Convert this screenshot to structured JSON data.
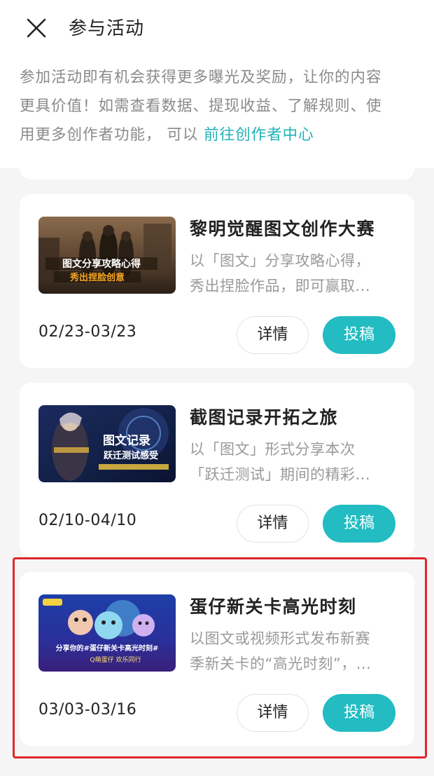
{
  "header": {
    "title": "参与活动",
    "close_icon": "close-icon"
  },
  "intro": {
    "line1": "参加活动即有机会获得更多曝光及奖励，让你的内容",
    "line2": "更具价值！如需查看数据、提现收益、了解规则、使",
    "line3_prefix": "用更多创作者功能， 可以 ",
    "link": "前往创作者中心"
  },
  "activities": [
    {
      "title": "黎明觉醒图文创作大赛",
      "desc_line1": "以「图文」分享攻略心得，",
      "desc_line2": "秀出捏脸作品，即可赢取...",
      "date": "02/23-03/23",
      "detail_label": "详情",
      "submit_label": "投稿",
      "banner_text1": "图文分享攻略心得",
      "banner_text2": "秀出捏脸创意"
    },
    {
      "title": "截图记录开拓之旅",
      "desc_line1": "以「图文」形式分享本次",
      "desc_line2": "「跃迁测试」期间的精彩...",
      "date": "02/10-04/10",
      "detail_label": "详情",
      "submit_label": "投稿",
      "banner_text1": "图文记录",
      "banner_text2": "跃迁测试感受"
    },
    {
      "title": "蛋仔新关卡高光时刻",
      "desc_line1": "以图文或视频形式发布新赛",
      "desc_line2": "季新关卡的“高光时刻”，...",
      "date": "03/03-03/16",
      "detail_label": "详情",
      "submit_label": "投稿",
      "banner_text1": "分享你的#蛋仔新关卡高光时刻#",
      "banner_text2": "Q萌蛋仔 欢乐同行"
    }
  ],
  "colors": {
    "accent": "#22bcc2",
    "link": "#1fb1b8",
    "highlight_border": "#e0262b"
  }
}
